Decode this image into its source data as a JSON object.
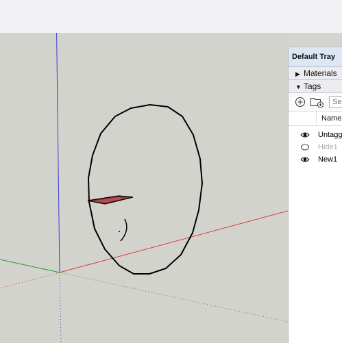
{
  "tray": {
    "title": "Default Tray",
    "sections": [
      {
        "label": "Materials",
        "expanded": false,
        "arrow": "▶"
      },
      {
        "label": "Tags",
        "expanded": true,
        "arrow": "▼"
      }
    ],
    "tags_panel": {
      "add_tag_icon": "add-tag-icon",
      "add_folder_icon": "add-tag-folder-icon",
      "search_placeholder": "Search",
      "column_name": "Name",
      "rows": [
        {
          "label": "Untagged",
          "visible": true
        },
        {
          "label": "Hide1",
          "visible": false
        },
        {
          "label": "New1",
          "visible": true
        }
      ]
    }
  },
  "colors": {
    "canvas": "#d3d3cd",
    "toolbar": "#f1f1f3",
    "red_axis": "#d83a3a",
    "green_axis": "#2a9a2a",
    "blue_axis": "#3a3ad8",
    "tray_title_bg": "#dde7f3"
  }
}
